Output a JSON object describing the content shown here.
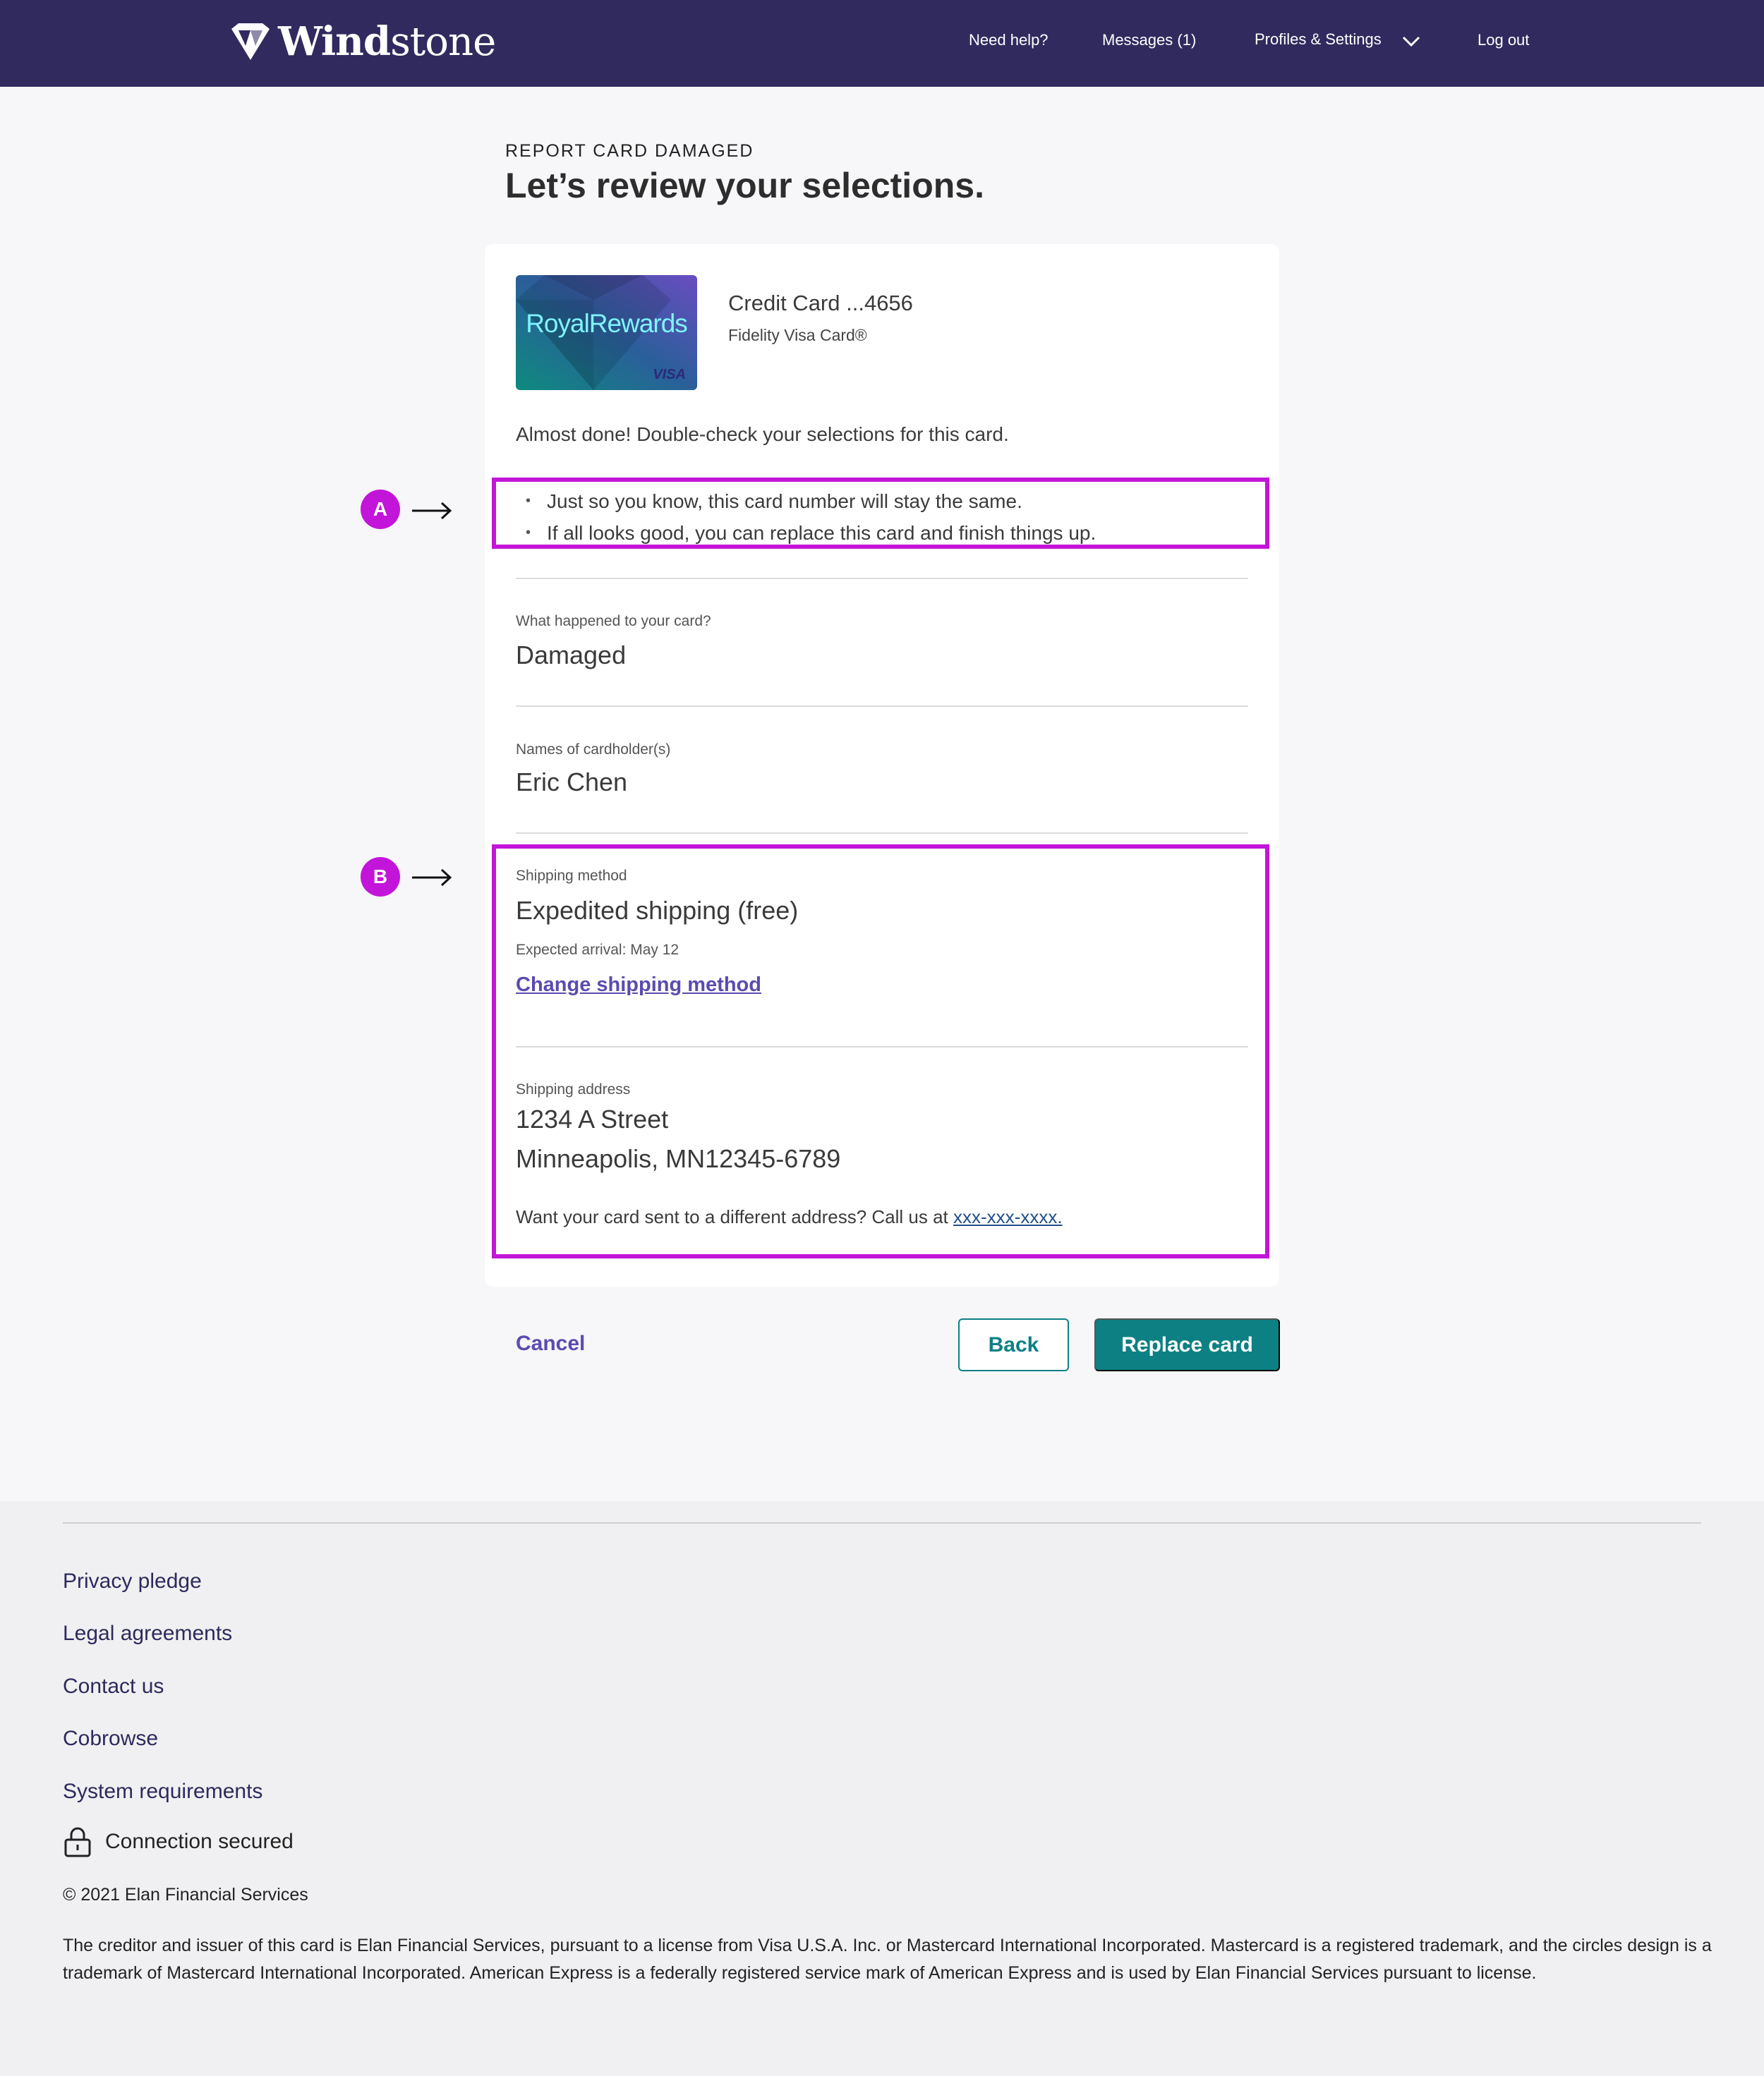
{
  "header": {
    "logo_text_bold": "Wind",
    "logo_text_light": "stone",
    "nav": {
      "help": "Need help?",
      "messages": "Messages (1)",
      "profiles": "Profiles & Settings",
      "logout": "Log out"
    },
    "background_color": "#312a5e"
  },
  "page": {
    "eyebrow": "REPORT CARD DAMAGED",
    "title": "Let’s review your selections."
  },
  "card": {
    "image_brand": "RoyalRewards",
    "image_network": "VISA",
    "title": "Credit Card ...4656",
    "subtitle": "Fidelity Visa Card®"
  },
  "review": {
    "intro": "Almost done! Double-check your selections for this card.",
    "bullets": [
      "Just so you know, this card number will stay the same.",
      "If all looks good, you can replace this card and finish things up."
    ],
    "what_happened": {
      "label": "What happened to your card?",
      "value": "Damaged"
    },
    "cardholders": {
      "label": "Names of cardholder(s)",
      "value": "Eric Chen"
    },
    "shipping_method": {
      "label": "Shipping method",
      "value": "Expedited shipping (free)",
      "arrival": "Expected arrival: May 12",
      "change_link": "Change shipping method"
    },
    "shipping_address": {
      "label": "Shipping address",
      "line1": "1234 A Street",
      "line2": "Minneapolis, MN12345-6789",
      "different_text": "Want your card sent to a different address? Call us at ",
      "phone_link": "xxx-xxx-xxxx."
    }
  },
  "annotations": {
    "marker_a": "A",
    "marker_b": "B",
    "highlight_color": "#c315d9"
  },
  "actions": {
    "cancel": "Cancel",
    "back": "Back",
    "replace": "Replace card",
    "primary_color": "#0d8084"
  },
  "footer": {
    "links": [
      "Privacy pledge",
      "Legal agreements",
      "Contact us",
      "Cobrowse",
      "System requirements"
    ],
    "secure": "Connection secured",
    "copyright": "© 2021 Elan Financial Services",
    "disclaimer": "The creditor and issuer of this card is Elan Financial Services, pursuant to a license from Visa U.S.A. Inc. or Mastercard International Incorporated. Mastercard is a registered trademark, and the circles design is a trademark of Mastercard International Incorporated. American Express is a federally registered service mark of American Express and is used by Elan Financial Services pursuant to license."
  }
}
